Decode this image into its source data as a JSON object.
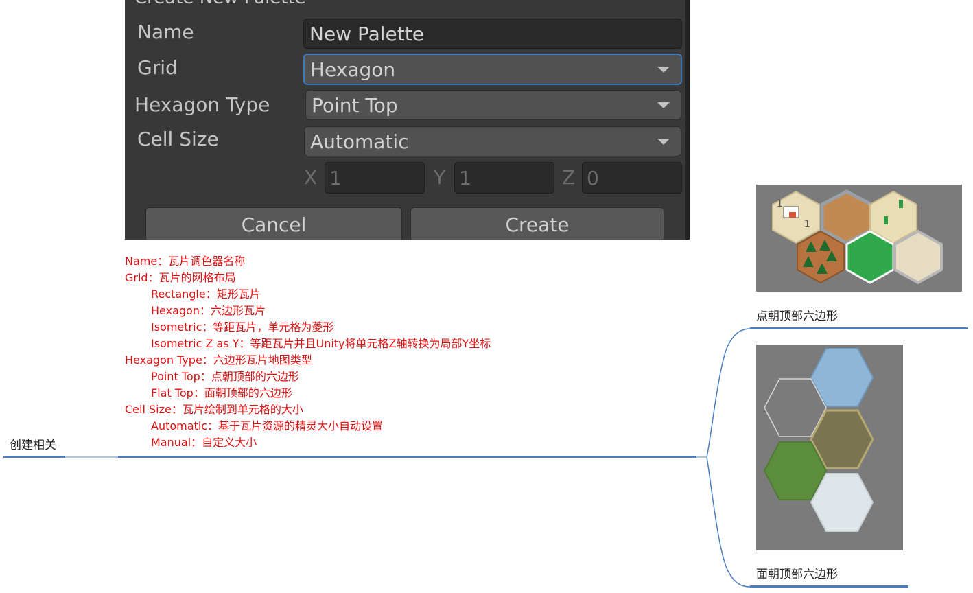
{
  "dialog": {
    "title": "Create New Palette",
    "name_label": "Name",
    "name_value": "New Palette",
    "grid_label": "Grid",
    "grid_value": "Hexagon",
    "hexagon_type_label": "Hexagon Type",
    "hexagon_type_value": "Point Top",
    "cell_size_label": "Cell Size",
    "cell_size_value": "Automatic",
    "x_label": "X",
    "x_value": "1",
    "y_label": "Y",
    "y_value": "1",
    "z_label": "Z",
    "z_value": "0",
    "cancel_label": "Cancel",
    "create_label": "Create"
  },
  "notes": [
    "Name：瓦片调色器名称",
    "Grid：瓦片的网格布局",
    "Rectangle：矩形瓦片",
    "Hexagon：六边形瓦片",
    "Isometric：等距瓦片，单元格为菱形",
    "Isometric Z as Y：等距瓦片并且Unity将单元格Z轴转换为局部Y坐标",
    "Hexagon Type：六边形瓦片地图类型",
    "Point Top：点朝顶部的六边形",
    "Flat Top：面朝顶部的六边形",
    "Cell Size：瓦片绘制到单元格的大小",
    "Automatic：基于瓦片资源的精灵大小自动设置",
    "Manual：自定义大小"
  ],
  "mindmap": {
    "root_label": "创建相关",
    "point_top_caption": "点朝顶部六边形",
    "flat_top_caption": "面朝顶部六边形"
  },
  "colors": {
    "dialog_bg": "#383838",
    "note_red": "#e01010",
    "connector_blue": "#4a7ec0",
    "focus_blue": "#3a79bb"
  }
}
